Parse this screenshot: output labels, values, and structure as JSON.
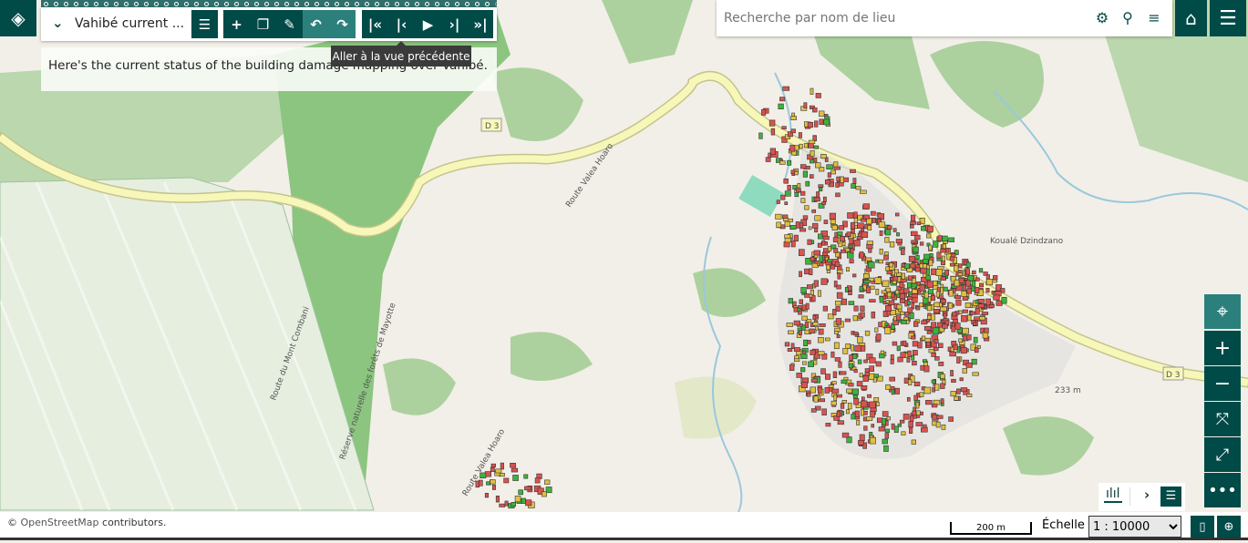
{
  "toolbar": {
    "title": "Vahibé current ...",
    "icons": [
      "chevron-down-icon",
      "list-icon",
      "plus-icon",
      "copy-icon",
      "pencil-icon",
      "undo-icon",
      "redo-icon",
      "first-icon",
      "previous-icon",
      "play-icon",
      "next-icon",
      "last-icon"
    ]
  },
  "tooltip": "Aller à la vue précédente",
  "description": "Here's the current status of the building damage mapping over Vahibé.",
  "search": {
    "placeholder": "Recherche par nom de lieu"
  },
  "map_labels": {
    "place": "Koualé Dzindzano",
    "road1": "D 3",
    "road2": "D 3",
    "elevation": "233 m",
    "route1": "Route Valea Hoaro",
    "route2": "Route Valea Hoaro",
    "route3": "Route du Mont Combani",
    "forest": "Réserve naturelle des forêts de Mayotte"
  },
  "colors": {
    "accent": "#004a47",
    "accent_light": "#2b807c",
    "damage_high": "#d9534f",
    "damage_mid": "#e0c040",
    "damage_low": "#3cb43c"
  },
  "footer": {
    "copyright": "©",
    "osm_link": "OpenStreetMap",
    "contributors": "contributors.",
    "scale_bar": "200 m",
    "scale_label": "Échelle :",
    "scale_value": "1 : 10000"
  }
}
